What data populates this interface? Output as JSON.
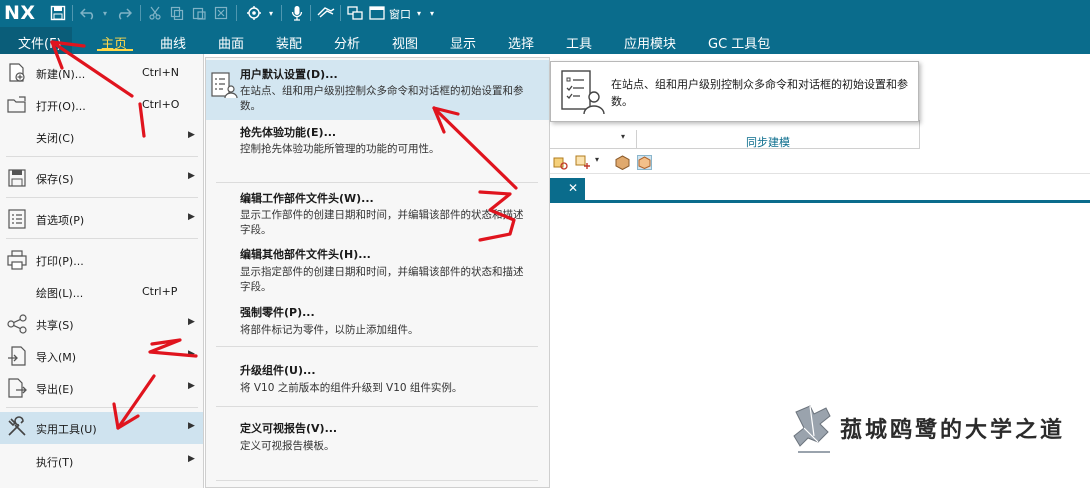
{
  "titlebar": {
    "logo": "NX",
    "window_menu": "窗口",
    "icons": [
      "save-icon",
      "undo-icon",
      "redo-icon",
      "cut-icon",
      "copy-icon",
      "paste-icon",
      "repeat-command-icon",
      "touch-mode-icon",
      "microphone-icon",
      "customer-defaults-icon",
      "switch-window-icon",
      "window-icon"
    ]
  },
  "menubar": {
    "file": "文件(F)",
    "tabs": [
      "主页",
      "曲线",
      "曲面",
      "装配",
      "分析",
      "视图",
      "显示",
      "选择",
      "工具",
      "应用模块",
      "GC 工具包"
    ],
    "active_tab": "主页"
  },
  "ribbon": {
    "group_label": "同步建模"
  },
  "file_menu": {
    "items": [
      {
        "label": "新建(N)...",
        "shortcut": "Ctrl+N",
        "has_submenu": false
      },
      {
        "label": "打开(O)...",
        "shortcut": "Ctrl+O",
        "has_submenu": false
      },
      {
        "label": "关闭(C)",
        "shortcut": "",
        "has_submenu": true
      },
      {
        "label": "保存(S)",
        "shortcut": "",
        "has_submenu": true
      },
      {
        "label": "首选项(P)",
        "shortcut": "",
        "has_submenu": true
      },
      {
        "label": "打印(P)...",
        "shortcut": "",
        "has_submenu": false
      },
      {
        "label": "绘图(L)...",
        "shortcut": "Ctrl+P",
        "has_submenu": false
      },
      {
        "label": "共享(S)",
        "shortcut": "",
        "has_submenu": true
      },
      {
        "label": "导入(M)",
        "shortcut": "",
        "has_submenu": true
      },
      {
        "label": "导出(E)",
        "shortcut": "",
        "has_submenu": true
      },
      {
        "label": "实用工具(U)",
        "shortcut": "",
        "has_submenu": true,
        "highlighted": true
      },
      {
        "label": "执行(T)",
        "shortcut": "",
        "has_submenu": true
      }
    ]
  },
  "utilities_submenu": {
    "items": [
      {
        "title": "用户默认设置(D)...",
        "desc": "在站点、组和用户级别控制众多命令和对话框的初始设置和参数。",
        "highlighted": true
      },
      {
        "title": "抢先体验功能(E)...",
        "desc": "控制抢先体验功能所管理的功能的可用性。"
      },
      {
        "title": "编辑工作部件文件头(W)...",
        "desc": "显示工作部件的创建日期和时间，并编辑该部件的状态和描述字段。"
      },
      {
        "title": "编辑其他部件文件头(H)...",
        "desc": "显示指定部件的创建日期和时间，并编辑该部件的状态和描述字段。"
      },
      {
        "title": "强制零件(P)...",
        "desc": "将部件标记为零件，以防止添加组件。"
      },
      {
        "title": "升级组件(U)...",
        "desc": "将 V10 之前版本的组件升级到 V10 组件实例。"
      },
      {
        "title": "定义可视报告(V)...",
        "desc": "定义可视报告模板。"
      }
    ]
  },
  "tooltip": {
    "text": "在站点、组和用户级别控制众多命令和对话框的初始设置和参数。"
  },
  "watermark": {
    "text": "菰城鸥鹭的大学之道"
  },
  "annotations": {
    "labels": [
      "1",
      "2",
      "3"
    ],
    "color": "#e0141e"
  },
  "colors": {
    "titlebar": "#0a6c8c",
    "active_tab": "#ffd84a",
    "menu_highlight": "#cfe3ef"
  }
}
